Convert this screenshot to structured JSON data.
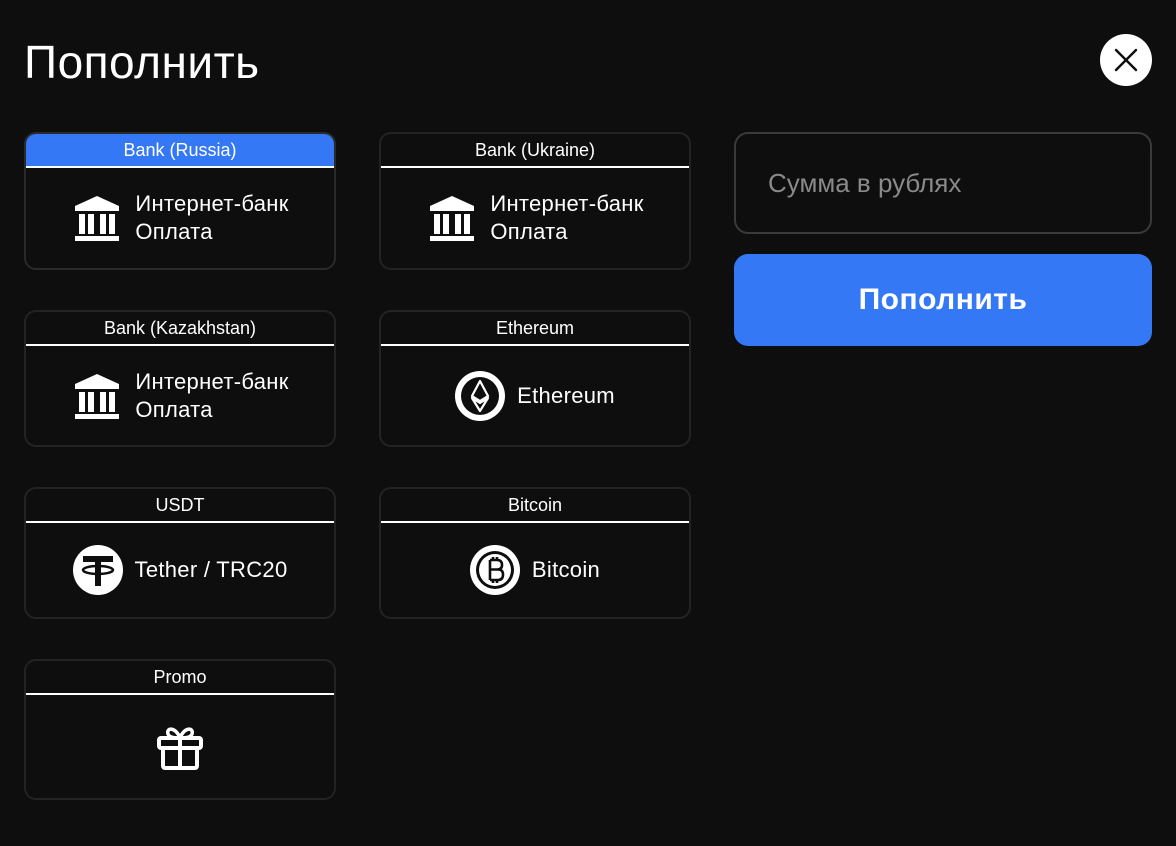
{
  "header": {
    "title": "Пополнить",
    "close_icon": "close-icon"
  },
  "methods": [
    {
      "category": "Bank (Russia)",
      "line1": "Интернет-банк",
      "line2": "Оплата",
      "icon": "bank-icon",
      "active": true
    },
    {
      "category": "Bank (Ukraine)",
      "line1": "Интернет-банк",
      "line2": "Оплата",
      "icon": "bank-icon",
      "active": false
    },
    {
      "category": "Bank (Kazakhstan)",
      "line1": "Интернет-банк",
      "line2": "Оплата",
      "icon": "bank-icon",
      "active": false
    },
    {
      "category": "Ethereum",
      "label": "Ethereum",
      "icon": "ethereum-icon",
      "active": false
    },
    {
      "category": "USDT",
      "label": "Tether / TRC20",
      "icon": "tether-icon",
      "active": false
    },
    {
      "category": "Bitcoin",
      "label": "Bitcoin",
      "icon": "bitcoin-icon",
      "active": false
    },
    {
      "category": "Promo",
      "icon": "gift-icon",
      "active": false
    }
  ],
  "form": {
    "amount_placeholder": "Сумма в рублях",
    "amount_value": "",
    "submit_label": "Пополнить"
  },
  "colors": {
    "background": "#0e0e0e",
    "accent": "#3478f6",
    "card_border": "#232323",
    "placeholder": "#8a8a8a"
  }
}
